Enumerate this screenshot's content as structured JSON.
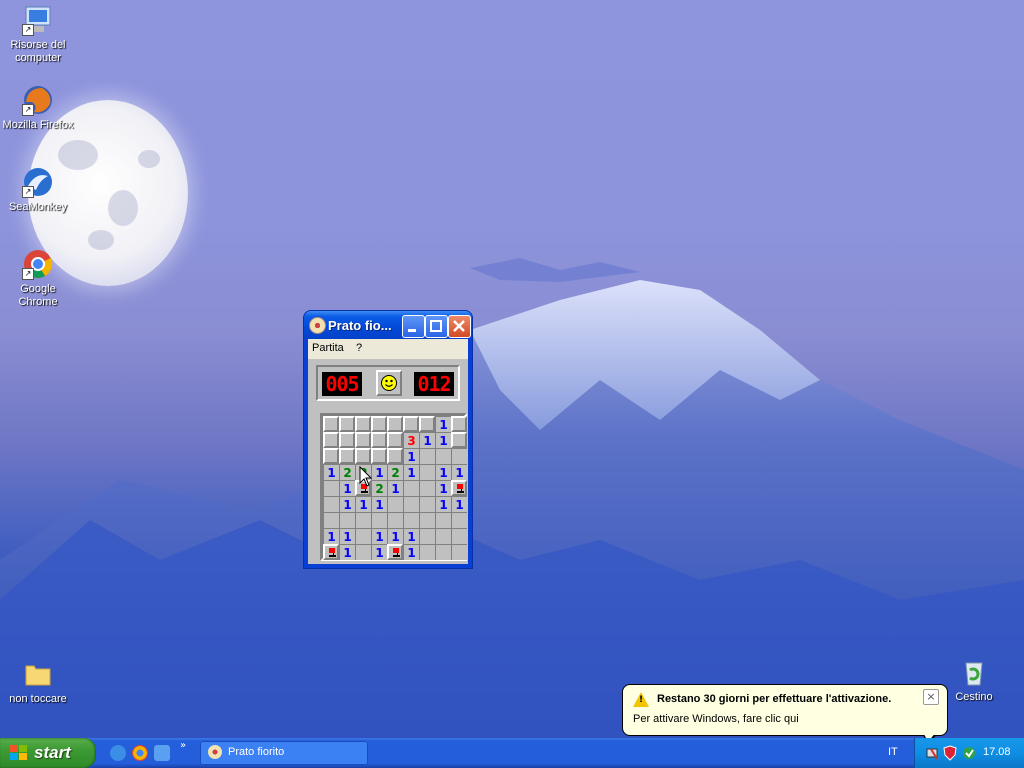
{
  "desktop": {
    "icons": [
      {
        "label_line1": "Risorse del",
        "label_line2": "computer",
        "icon": "computer-icon"
      },
      {
        "label_line1": "Mozilla Firefox",
        "label_line2": "",
        "icon": "firefox-icon"
      },
      {
        "label_line1": "SeaMonkey",
        "label_line2": "",
        "icon": "seamonkey-icon"
      },
      {
        "label_line1": "Google Chrome",
        "label_line2": "",
        "icon": "chrome-icon"
      },
      {
        "label_line1": "non toccare",
        "label_line2": "",
        "icon": "folder-icon"
      },
      {
        "label_line1": "Cestino",
        "label_line2": "",
        "icon": "recycle-bin-icon"
      }
    ]
  },
  "window": {
    "title": "Prato fio...",
    "menu": [
      "Partita",
      "?"
    ],
    "mine_counter": "005",
    "timer": "012"
  },
  "board": {
    "rows": [
      [
        "U",
        "U",
        "U",
        "U",
        "U",
        "U",
        "U",
        "1",
        "U"
      ],
      [
        "U",
        "U",
        "U",
        "U",
        "U",
        "3",
        "1",
        "1",
        "U"
      ],
      [
        "U",
        "U",
        "U",
        "U",
        "U",
        "1",
        "",
        "",
        ""
      ],
      [
        "1",
        "2",
        "2",
        "1",
        "2",
        "1",
        "",
        "1",
        "1"
      ],
      [
        "",
        "1",
        "F",
        "2",
        "1",
        "",
        "",
        "1",
        "F"
      ],
      [
        "",
        "1",
        "1",
        "1",
        "",
        "",
        "",
        "1",
        "1"
      ],
      [
        "",
        "",
        "",
        "",
        "",
        "",
        "",
        "",
        ""
      ],
      [
        "1",
        "1",
        "",
        "1",
        "1",
        "1",
        "",
        "",
        ""
      ],
      [
        "F",
        "1",
        "",
        "1",
        "F",
        "1",
        "",
        "",
        ""
      ]
    ]
  },
  "taskbar": {
    "start_label": "start",
    "task_label": "Prato fiorito",
    "language": "IT",
    "clock": "17.08"
  },
  "balloon": {
    "title": "Restano 30 giorni per effettuare l'attivazione.",
    "text": "Per attivare Windows, fare clic qui",
    "close": "×"
  }
}
